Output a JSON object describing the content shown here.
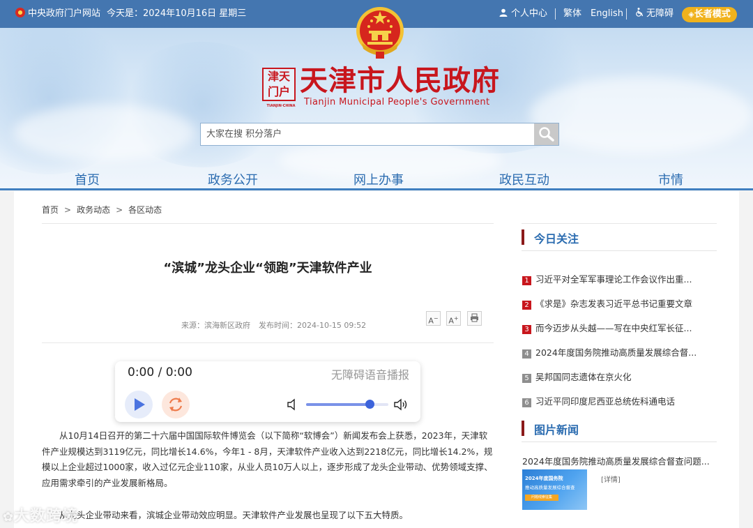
{
  "topbar": {
    "gov_portal": "中央政府门户网站",
    "date_label": "今天是：2024年10月16日 星期三",
    "personal_center": "个人中心",
    "traditional": "繁体",
    "english": "English",
    "accessibility": "无障碍",
    "elder_mode": "长者模式"
  },
  "brand": {
    "title": "天津市人民政府",
    "subtitle": "Tianjin Municipal People's Government",
    "seal_text": "津天",
    "seal_text2": "门户",
    "seal_caption": "TIANJIN·CHINA"
  },
  "search": {
    "placeholder": "大家在搜 积分落户"
  },
  "nav": {
    "items": [
      {
        "label": "首页"
      },
      {
        "label": "政务公开"
      },
      {
        "label": "网上办事"
      },
      {
        "label": "政民互动"
      },
      {
        "label": "市情"
      }
    ]
  },
  "breadcrumb": {
    "items": [
      "首页",
      "政务动态",
      "各区动态"
    ],
    "separator": ">"
  },
  "article": {
    "title": "“滨城”龙头企业“领跑”天津软件产业",
    "source": "来源：滨海新区政府",
    "publish_time": "发布时间：2024-10-15 09:52",
    "font_smaller": "A",
    "font_larger": "A",
    "paragraphs": [
      "从10月14日召开的第二十六届中国国际软件博览会（以下简称“软博会”）新闻发布会上获悉，2023年，天津软件产业规模达到3119亿元，同比增长14.6%，今年1 - 8月，天津软件产业收入达到2218亿元，同比增长14.2%，规模以上企业超过1000家，收入过亿元企业110家，从业人员10万人以上，逐步形成了龙头企业带动、优势领域支撑、应用需求牵引的产业发展新格局。",
      "从龙头企业带动来看，滨城企业带动效应明显。天津软件产业发展也呈现了以下五大特质。"
    ]
  },
  "player": {
    "time": "0:00 / 0:00",
    "label": "无障碍语音播报",
    "volume": 0.78
  },
  "sidebar": {
    "today_heading": "今日关注",
    "today_items": [
      {
        "num": "1",
        "text": "习近平对全军军事理论工作会议作出重...",
        "hot": true
      },
      {
        "num": "2",
        "text": "《求是》杂志发表习近平总书记重要文章",
        "hot": true
      },
      {
        "num": "3",
        "text": "而今迈步从头越——写在中央红军长征...",
        "hot": true
      },
      {
        "num": "4",
        "text": "2024年度国务院推动高质量发展综合督...",
        "hot": false
      },
      {
        "num": "5",
        "text": "吴邦国同志遗体在京火化",
        "hot": false
      },
      {
        "num": "6",
        "text": "习近平同印度尼西亚总统佐科通电话",
        "hot": false
      }
    ],
    "pic_heading": "图片新闻",
    "pic_item": {
      "title": "2024年度国务院推动高质量发展综合督查问题...",
      "thumb_line1": "2024年度国务院",
      "thumb_line2": "推动高质量发展综合督查",
      "thumb_tag": "问题线索征集",
      "detail": "[详情]"
    }
  },
  "watermark": {
    "text": "大数跨境"
  },
  "colors": {
    "topbar": "#3a6eaa",
    "brand_red": "#c8161d",
    "nav_blue": "#2b6cb0",
    "elder_orange": "#f0b21c"
  }
}
